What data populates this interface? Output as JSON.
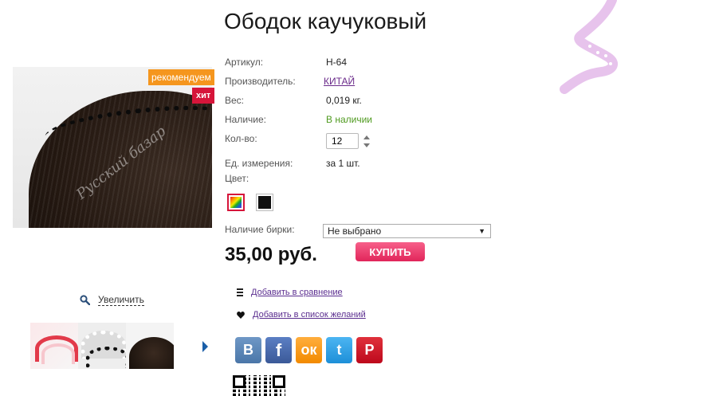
{
  "product": {
    "title": "Ободок каучуковый",
    "badges": {
      "recommend": "рекомендуем",
      "hit": "хит"
    },
    "image_watermark": "Русский базар",
    "zoom_label": "Увеличить"
  },
  "attributes": {
    "sku_label": "Артикул:",
    "sku_value": "H-64",
    "manufacturer_label": "Производитель:",
    "manufacturer_value": "КИТАЙ",
    "weight_label": "Вес:",
    "weight_value": "0,019 кг.",
    "availability_label": "Наличие:",
    "availability_value": "В наличии",
    "quantity_label": "Кол-во:",
    "quantity_value": "12",
    "unit_label": "Ед. измерения:",
    "unit_value": "за 1 шт.",
    "color_label": "Цвет:",
    "color_options": [
      "multicolor",
      "black"
    ],
    "selected_color": "multicolor",
    "tag_label": "Наличие бирки:",
    "tag_value": "Не выбрано"
  },
  "price": "35,00 руб.",
  "buy_label": "КУПИТЬ",
  "actions": {
    "compare_label": "Добавить в сравнение",
    "wishlist_label": " Добавить в список желаний"
  },
  "share": {
    "vk": "В",
    "facebook": "f",
    "odnoklassniki": "ок",
    "twitter": "t",
    "pinterest": "P"
  },
  "colors": {
    "accent": "#e1255a",
    "badge_recommend": "#f5961e",
    "badge_hit": "#d6153a",
    "link": "#5a2d8f",
    "in_stock": "#4f9a1f"
  }
}
